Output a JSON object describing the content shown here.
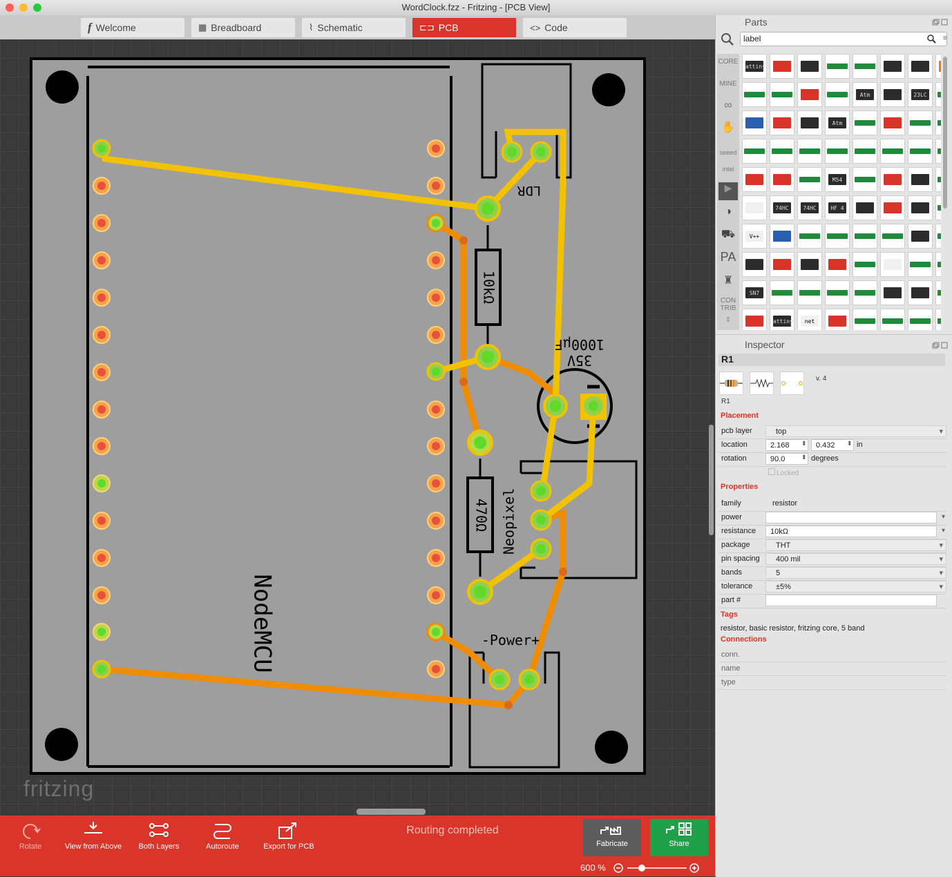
{
  "window": {
    "title": "WordClock.fzz - Fritzing - [PCB View]"
  },
  "tabs": [
    {
      "label": "Welcome",
      "icon": "f-logo-icon"
    },
    {
      "label": "Breadboard",
      "icon": "breadboard-icon"
    },
    {
      "label": "Schematic",
      "icon": "schematic-icon"
    },
    {
      "label": "PCB",
      "icon": "pcb-icon",
      "active": true
    },
    {
      "label": "Code",
      "icon": "code-icon"
    }
  ],
  "pcb": {
    "labels": {
      "ldr": "LDR",
      "r_top": "10kΩ",
      "cap_v": "35V",
      "cap_c": "1000μF",
      "neopixel": "Neopixel",
      "r_bottom": "470Ω",
      "nodemcu": "NodeMCU",
      "power": "-Power+"
    },
    "logo": "fritzing"
  },
  "toolbar": {
    "rotate": "Rotate",
    "view_from_above": "View from Above",
    "both_layers": "Both Layers",
    "autoroute": "Autoroute",
    "export": "Export for PCB",
    "status": "Routing completed",
    "fabricate": "Fabricate",
    "share": "Share",
    "zoom": "600 %"
  },
  "parts": {
    "title": "Parts",
    "search_value": "label",
    "bins": [
      "CORE",
      "MINE",
      "arduino",
      "fab",
      "seeed",
      "intel",
      "video",
      "sparkfun",
      "car",
      "PA",
      "piano",
      "CON TRIB"
    ],
    "bin_labels": {
      "core": "CORE",
      "mine": "MINE",
      "seeed": "seeed",
      "intel": "intel",
      "contrib1": "CON",
      "contrib2": "TRIB",
      "pa": "PA"
    },
    "chip_texts": {
      "attiny": "attiny",
      "atm": "Atm",
      "c23": "23LC",
      "m54": "M54",
      "hc74": "74HC",
      "hf": "HF 4",
      "netlabel": "net label",
      "vpp": "V++",
      "sn7": "SN7"
    }
  },
  "inspector": {
    "title": "Inspector",
    "part": "R1",
    "part_caption": "R1",
    "version": "v. 4",
    "placement_header": "Placement",
    "pcb_layer_label": "pcb layer",
    "pcb_layer": "top",
    "location_label": "location",
    "location_x": "2.168",
    "location_y": "0.432",
    "location_unit": "in",
    "rotation_label": "rotation",
    "rotation": "90.0",
    "rotation_unit": "degrees",
    "locked": "Locked",
    "properties_header": "Properties",
    "props": [
      {
        "k": "family",
        "v": "resistor",
        "kind": "plain"
      },
      {
        "k": "power",
        "v": "",
        "kind": "in"
      },
      {
        "k": "resistance",
        "v": "10kΩ",
        "kind": "in"
      },
      {
        "k": "package",
        "v": "THT",
        "kind": "dd"
      },
      {
        "k": "pin spacing",
        "v": "400 mil",
        "kind": "dd"
      },
      {
        "k": "bands",
        "v": "5",
        "kind": "dd"
      },
      {
        "k": "tolerance",
        "v": "±5%",
        "kind": "dd"
      },
      {
        "k": "part #",
        "v": "",
        "kind": "in"
      }
    ],
    "tags_header": "Tags",
    "tags": "resistor, basic resistor, fritzing core, 5 band",
    "connections_header": "Connections",
    "connections": [
      "conn.",
      "name",
      "type"
    ]
  }
}
